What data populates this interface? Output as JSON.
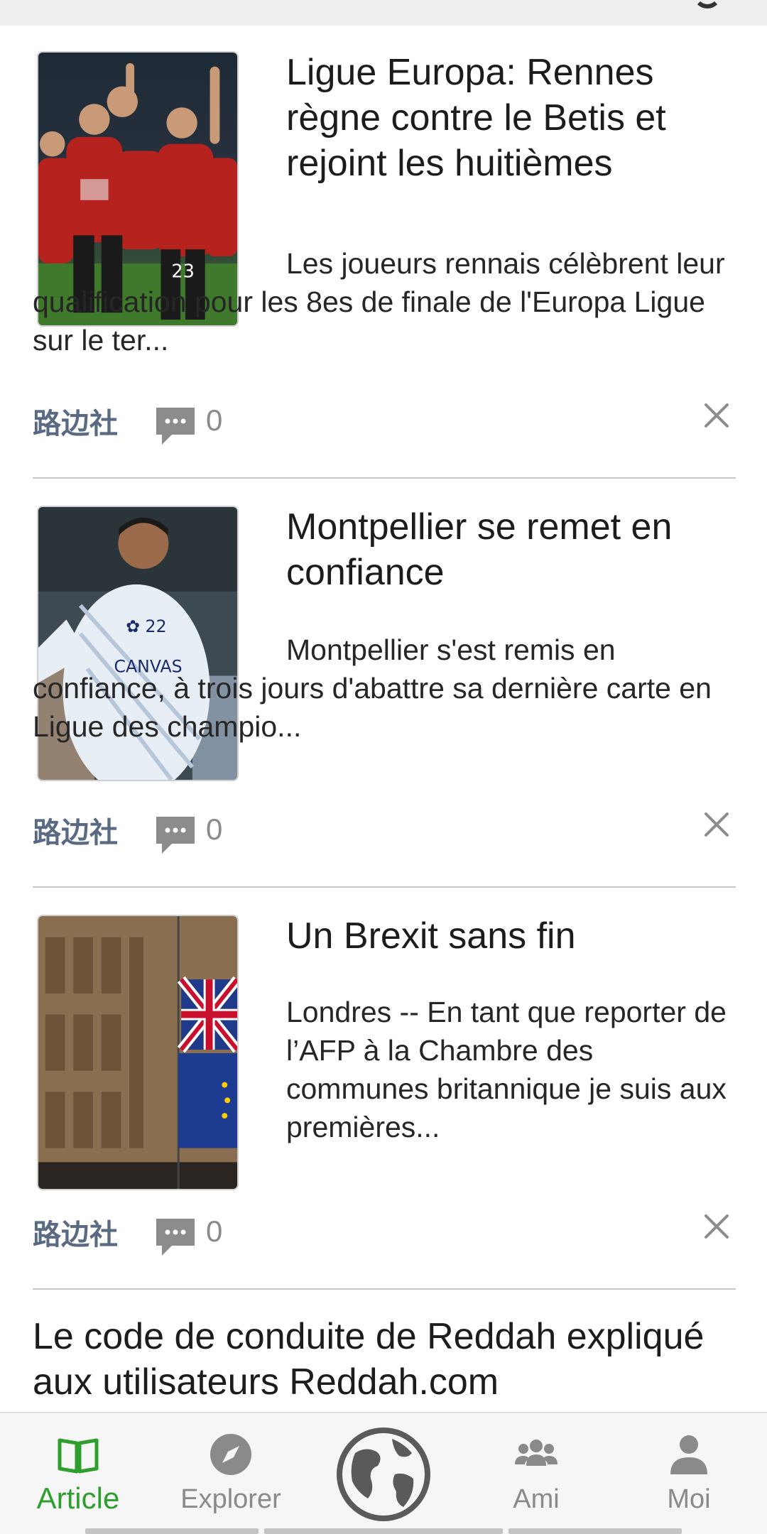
{
  "articles": [
    {
      "title": "Ligue Europa: Rennes règne contre le Betis et rejoint les huitièmes",
      "summary": "Les joueurs rennais célèbrent leur qualification pour les 8es de finale de l'Europa Ligue sur le ter...",
      "source": "路边社",
      "comment_count": "0"
    },
    {
      "title": "Montpellier se remet en confiance",
      "summary": "Montpellier s'est remis en confiance, à trois jours d'abattre sa dernière carte en Ligue des champio...",
      "source": "路边社",
      "comment_count": "0"
    },
    {
      "title": "Un Brexit sans fin",
      "summary": "Londres -- En tant que reporter de l’AFP à la Chambre des communes britannique je suis aux premières...",
      "source": "路边社",
      "comment_count": "0"
    },
    {
      "title": "Le code de conduite de Reddah expliqué aux utilisateurs Reddah.com"
    }
  ],
  "nav": {
    "article": "Article",
    "explorer": "Explorer",
    "ami": "Ami",
    "moi": "Moi",
    "active_color": "#2e9e2e",
    "inactive_color": "#8a8a8a"
  },
  "icons": {
    "comment": "comment-bubble-icon",
    "close": "close-icon",
    "article": "book-icon",
    "explorer": "compass-icon",
    "globe": "globe-icon",
    "ami": "people-icon",
    "moi": "person-icon"
  }
}
